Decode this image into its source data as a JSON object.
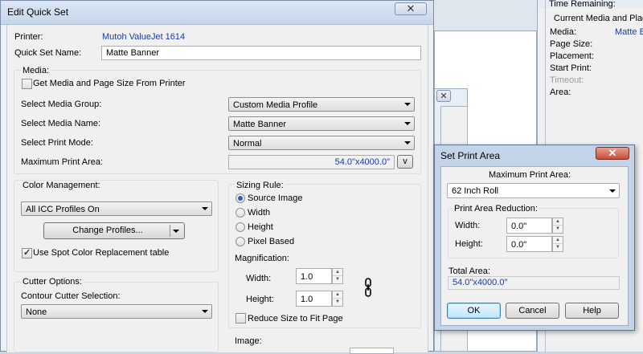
{
  "background_window": {
    "time_remaining_label": "Time Remaining:",
    "current_media_header": "Current Media and Placem",
    "rows": [
      {
        "label": "Media:",
        "value": "Matte B"
      },
      {
        "label": "Page Size:",
        "value": ""
      },
      {
        "label": "Placement:",
        "value": ""
      },
      {
        "label": "Start Print:",
        "value": ""
      },
      {
        "label": "Timeout:",
        "value": ""
      },
      {
        "label": "Area:",
        "value": ""
      }
    ]
  },
  "edit_quick_set": {
    "title": "Edit Quick Set",
    "close_label": "✕",
    "printer_label": "Printer:",
    "printer_value": "Mutoh ValueJet 1614",
    "quick_set_name_label": "Quick Set Name:",
    "quick_set_name_value": "Matte Banner",
    "media": {
      "group_label": "Media:",
      "get_from_printer_label": "Get Media and Page Size From Printer",
      "get_from_printer_checked": false,
      "media_group_label": "Select Media Group:",
      "media_group_value": "Custom Media Profile",
      "media_name_label": "Select Media Name:",
      "media_name_value": "Matte Banner",
      "print_mode_label": "Select Print Mode:",
      "print_mode_value": "Normal",
      "max_area_label": "Maximum Print Area:",
      "max_area_value": "54.0\"x4000.0\"",
      "max_area_button": "v"
    },
    "color_management": {
      "group_label": "Color Management:",
      "profile_value": "All ICC Profiles On",
      "change_profiles_label": "Change Profiles...",
      "spot_color_label": "Use Spot Color Replacement table",
      "spot_color_checked": true
    },
    "sizing_rule": {
      "group_label": "Sizing Rule:",
      "options": [
        "Source Image",
        "Width",
        "Height",
        "Pixel Based"
      ],
      "selected": "Source Image",
      "magnification_label": "Magnification:",
      "width_label": "Width:",
      "width_value": "1.0",
      "height_label": "Height:",
      "height_value": "1.0",
      "reduce_label": "Reduce Size to Fit Page",
      "reduce_checked": false
    },
    "cutter": {
      "group_label": "Cutter Options:",
      "contour_label": "Contour Cutter Selection:",
      "contour_value": "None"
    },
    "image_label": "Image:"
  },
  "set_print_area": {
    "title": "Set Print Area",
    "close_label": "✕",
    "max_area_label": "Maximum Print Area:",
    "max_area_value": "62 Inch Roll",
    "reduction_label": "Print Area Reduction:",
    "width_label": "Width:",
    "width_value": "0.0\"",
    "height_label": "Height:",
    "height_value": "0.0\"",
    "total_area_label": "Total Area:",
    "total_area_value": "54.0\"x4000.0\"",
    "ok_label": "OK",
    "cancel_label": "Cancel",
    "help_label": "Help"
  }
}
